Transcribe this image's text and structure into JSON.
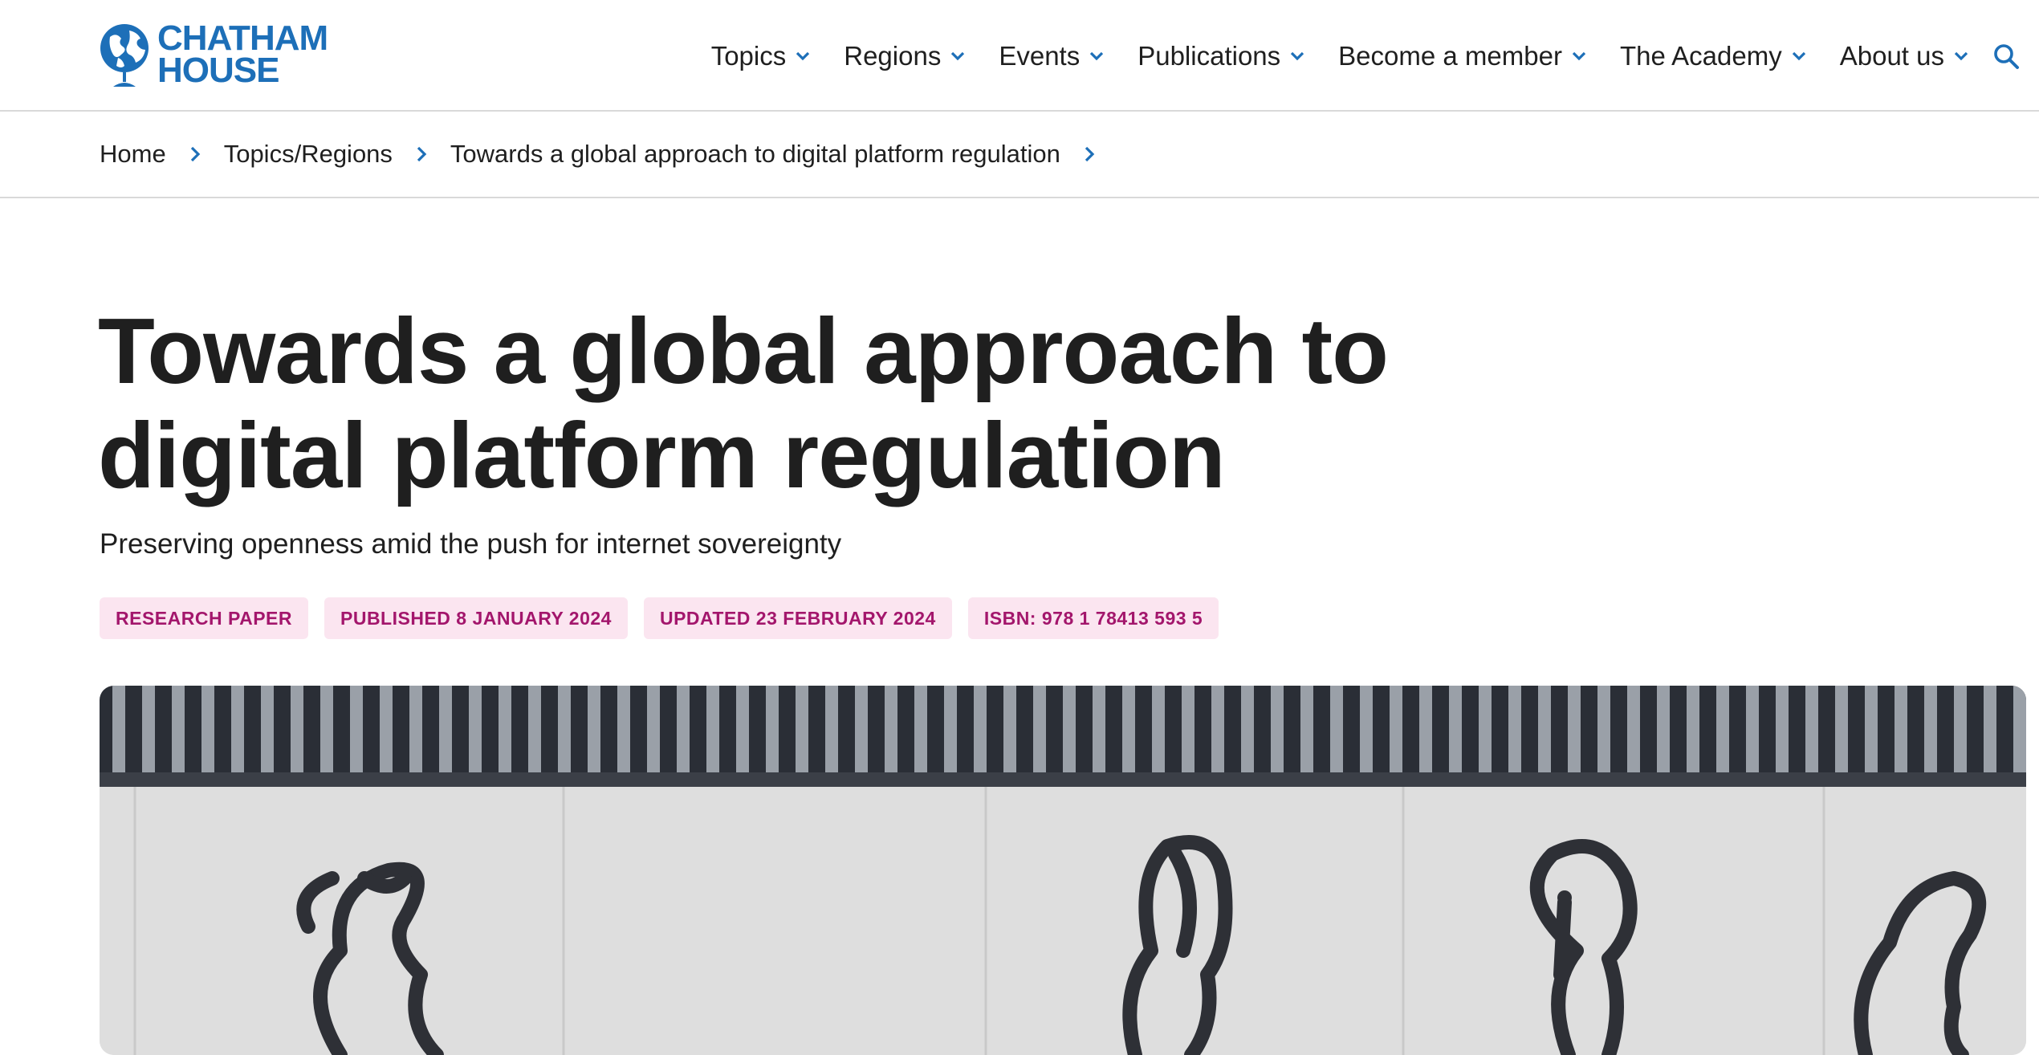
{
  "site": {
    "logo_line1": "CHATHAM",
    "logo_line2": "HOUSE",
    "brand_color": "#1d6fb8",
    "logo_icon": "globe-icon"
  },
  "nav": {
    "items": [
      {
        "label": "Topics"
      },
      {
        "label": "Regions"
      },
      {
        "label": "Events"
      },
      {
        "label": "Publications"
      },
      {
        "label": "Become a member"
      },
      {
        "label": "The Academy"
      },
      {
        "label": "About us"
      }
    ],
    "search_icon": "search-icon"
  },
  "breadcrumb": [
    {
      "label": "Home"
    },
    {
      "label": "Topics/Regions"
    },
    {
      "label": "Towards a global approach to digital platform regulation"
    }
  ],
  "article": {
    "title": "Towards a global approach to digital platform regulation",
    "subtitle": "Preserving openness amid the push for internet sovereignty",
    "tags": [
      {
        "label": "RESEARCH PAPER"
      },
      {
        "label": "PUBLISHED 8 JANUARY 2024"
      },
      {
        "label": "UPDATED 23 FEBRUARY 2024"
      },
      {
        "label": "ISBN: 978 1 78413 593 5"
      }
    ],
    "tag_bg_color": "#fbe5f0",
    "tag_text_color": "#a3166c"
  }
}
